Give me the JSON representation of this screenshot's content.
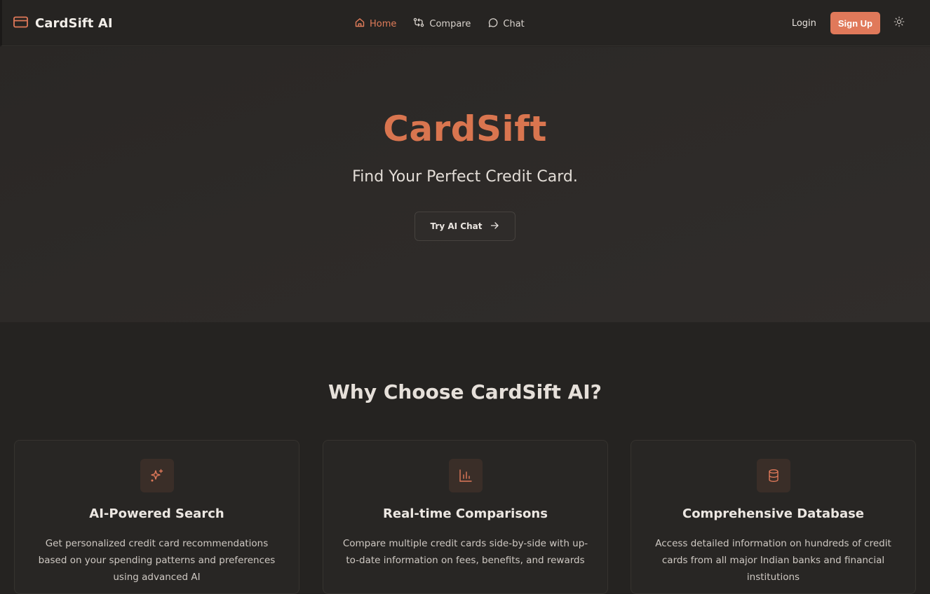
{
  "nav": {
    "brand": "CardSift AI",
    "links": [
      {
        "label": "Home",
        "icon": "home-icon",
        "active": true
      },
      {
        "label": "Compare",
        "icon": "compare-icon",
        "active": false
      },
      {
        "label": "Chat",
        "icon": "chat-icon",
        "active": false
      }
    ],
    "login": "Login",
    "signup": "Sign Up",
    "theme_icon": "sun-icon"
  },
  "hero": {
    "title": "CardSift",
    "subtitle": "Find Your Perfect Credit Card.",
    "cta": "Try AI Chat"
  },
  "features": {
    "title": "Why Choose CardSift AI?",
    "cards": [
      {
        "icon": "sparkles-icon",
        "title": "AI-Powered Search",
        "desc": "Get personalized credit card recommendations based on your spending patterns and preferences using advanced AI"
      },
      {
        "icon": "bar-chart-icon",
        "title": "Real-time Comparisons",
        "desc": "Compare multiple credit cards side-by-side with up-to-date information on fees, benefits, and rewards"
      },
      {
        "icon": "database-icon",
        "title": "Comprehensive Database",
        "desc": "Access detailed information on hundreds of credit cards from all major Indian banks and financial institutions"
      }
    ]
  },
  "colors": {
    "accent": "#e0795a",
    "background": "#252321",
    "hero_title": "#d9754f"
  }
}
